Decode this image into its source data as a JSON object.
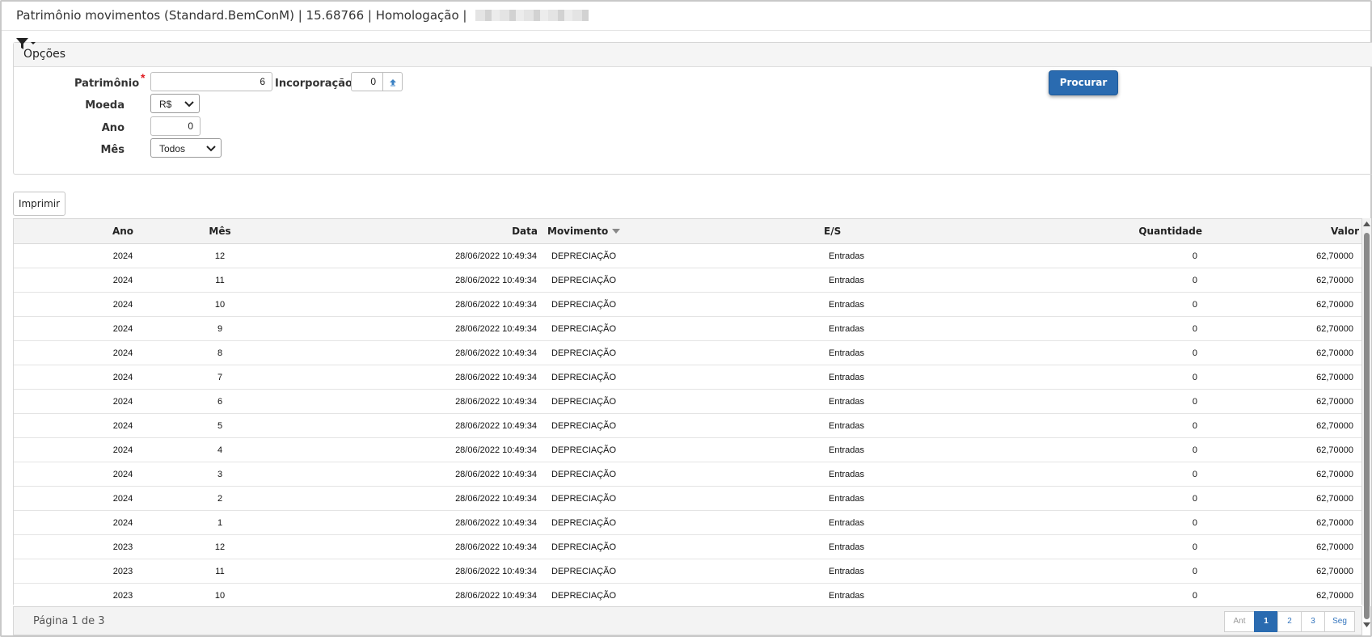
{
  "window": {
    "title": "Patrimônio movimentos (Standard.BemConM) | 15.68766 | Homologação |"
  },
  "options": {
    "title": "Opções",
    "filter_icon": "filter-dropdown-icon",
    "patrimonio": {
      "label": "Patrimônio",
      "required_mark": "*",
      "value": "6"
    },
    "incorporacao": {
      "label": "Incorporação",
      "value": "0",
      "button_icon": "arrow-up-icon"
    },
    "moeda": {
      "label": "Moeda",
      "value": "R$"
    },
    "ano": {
      "label": "Ano",
      "value": "0"
    },
    "mes": {
      "label": "Mês",
      "value": "Todos"
    },
    "search_button": "Procurar"
  },
  "toolbar": {
    "print_button": "Imprimir"
  },
  "grid": {
    "columns": {
      "ano": "Ano",
      "mes": "Mês",
      "data": "Data",
      "movimento": "Movimento",
      "es": "E/S",
      "quantidade": "Quantidade",
      "valor": "Valor"
    },
    "sort_icon": "sort-desc-icon",
    "rows": [
      {
        "ano": "2024",
        "mes": "12",
        "data": "28/06/2022 10:49:34",
        "movimento": "DEPRECIAÇÃO",
        "es": "Entradas",
        "quantidade": "0",
        "valor": "62,70000"
      },
      {
        "ano": "2024",
        "mes": "11",
        "data": "28/06/2022 10:49:34",
        "movimento": "DEPRECIAÇÃO",
        "es": "Entradas",
        "quantidade": "0",
        "valor": "62,70000"
      },
      {
        "ano": "2024",
        "mes": "10",
        "data": "28/06/2022 10:49:34",
        "movimento": "DEPRECIAÇÃO",
        "es": "Entradas",
        "quantidade": "0",
        "valor": "62,70000"
      },
      {
        "ano": "2024",
        "mes": "9",
        "data": "28/06/2022 10:49:34",
        "movimento": "DEPRECIAÇÃO",
        "es": "Entradas",
        "quantidade": "0",
        "valor": "62,70000"
      },
      {
        "ano": "2024",
        "mes": "8",
        "data": "28/06/2022 10:49:34",
        "movimento": "DEPRECIAÇÃO",
        "es": "Entradas",
        "quantidade": "0",
        "valor": "62,70000"
      },
      {
        "ano": "2024",
        "mes": "7",
        "data": "28/06/2022 10:49:34",
        "movimento": "DEPRECIAÇÃO",
        "es": "Entradas",
        "quantidade": "0",
        "valor": "62,70000"
      },
      {
        "ano": "2024",
        "mes": "6",
        "data": "28/06/2022 10:49:34",
        "movimento": "DEPRECIAÇÃO",
        "es": "Entradas",
        "quantidade": "0",
        "valor": "62,70000"
      },
      {
        "ano": "2024",
        "mes": "5",
        "data": "28/06/2022 10:49:34",
        "movimento": "DEPRECIAÇÃO",
        "es": "Entradas",
        "quantidade": "0",
        "valor": "62,70000"
      },
      {
        "ano": "2024",
        "mes": "4",
        "data": "28/06/2022 10:49:34",
        "movimento": "DEPRECIAÇÃO",
        "es": "Entradas",
        "quantidade": "0",
        "valor": "62,70000"
      },
      {
        "ano": "2024",
        "mes": "3",
        "data": "28/06/2022 10:49:34",
        "movimento": "DEPRECIAÇÃO",
        "es": "Entradas",
        "quantidade": "0",
        "valor": "62,70000"
      },
      {
        "ano": "2024",
        "mes": "2",
        "data": "28/06/2022 10:49:34",
        "movimento": "DEPRECIAÇÃO",
        "es": "Entradas",
        "quantidade": "0",
        "valor": "62,70000"
      },
      {
        "ano": "2024",
        "mes": "1",
        "data": "28/06/2022 10:49:34",
        "movimento": "DEPRECIAÇÃO",
        "es": "Entradas",
        "quantidade": "0",
        "valor": "62,70000"
      },
      {
        "ano": "2023",
        "mes": "12",
        "data": "28/06/2022 10:49:34",
        "movimento": "DEPRECIAÇÃO",
        "es": "Entradas",
        "quantidade": "0",
        "valor": "62,70000"
      },
      {
        "ano": "2023",
        "mes": "11",
        "data": "28/06/2022 10:49:34",
        "movimento": "DEPRECIAÇÃO",
        "es": "Entradas",
        "quantidade": "0",
        "valor": "62,70000"
      },
      {
        "ano": "2023",
        "mes": "10",
        "data": "28/06/2022 10:49:34",
        "movimento": "DEPRECIAÇÃO",
        "es": "Entradas",
        "quantidade": "0",
        "valor": "62,70000"
      }
    ]
  },
  "footer": {
    "page_info": "Página 1 de 3",
    "pagination": [
      {
        "label": "Ant",
        "state": "disabled"
      },
      {
        "label": "1",
        "state": "active"
      },
      {
        "label": "2",
        "state": "normal"
      },
      {
        "label": "3",
        "state": "normal"
      },
      {
        "label": "Seg",
        "state": "normal"
      }
    ]
  },
  "colors": {
    "primary": "#2a6bb0",
    "link": "#3576be",
    "required": "#e0191f"
  }
}
